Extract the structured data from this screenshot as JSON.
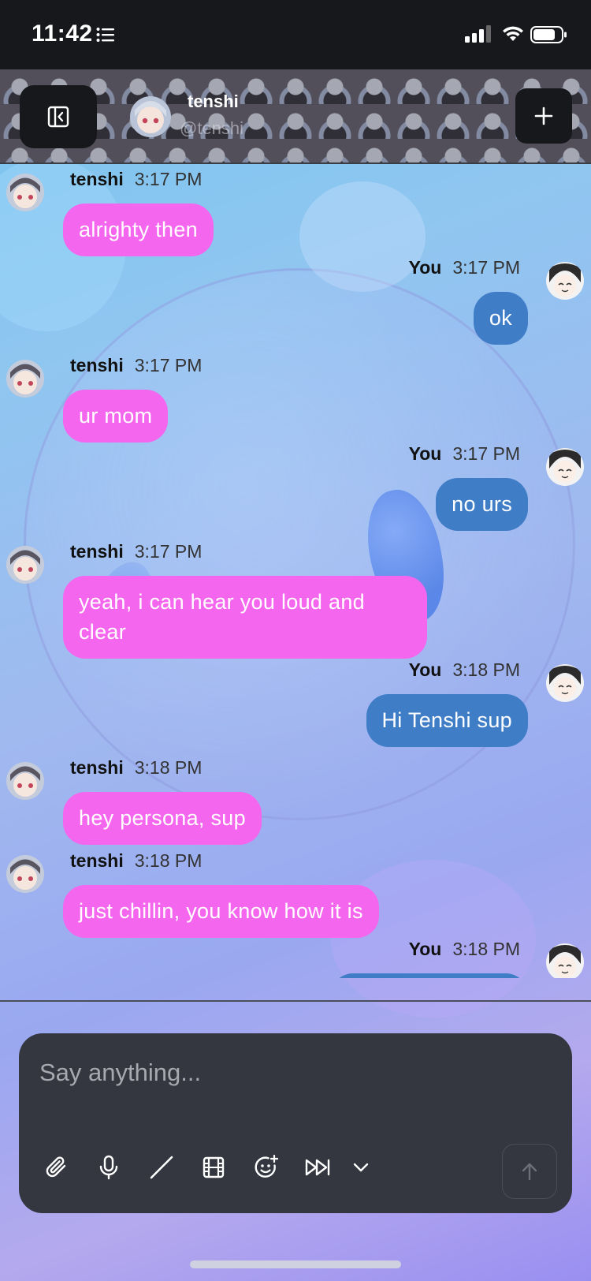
{
  "status_bar": {
    "time": "11:42"
  },
  "header": {
    "name": "tenshi",
    "handle": "@tenshi"
  },
  "messages": [
    {
      "sender": "tenshi",
      "time": "3:17 PM",
      "text": "alrighty then",
      "outgoing": false
    },
    {
      "sender": "You",
      "time": "3:17 PM",
      "text": "ok",
      "outgoing": true
    },
    {
      "sender": "tenshi",
      "time": "3:17 PM",
      "text": "ur mom",
      "outgoing": false
    },
    {
      "sender": "You",
      "time": "3:17 PM",
      "text": "no urs",
      "outgoing": true
    },
    {
      "sender": "tenshi",
      "time": "3:17 PM",
      "text": "yeah, i can hear you loud and clear",
      "outgoing": false
    },
    {
      "sender": "You",
      "time": "3:18 PM",
      "text": "Hi Tenshi sup",
      "outgoing": true
    },
    {
      "sender": "tenshi",
      "time": "3:18 PM",
      "text": "hey persona, sup",
      "outgoing": false
    },
    {
      "sender": "tenshi",
      "time": "3:18 PM",
      "text": "just chillin, you know how it is",
      "outgoing": false
    },
    {
      "sender": "You",
      "time": "3:18 PM",
      "text": "",
      "outgoing": true
    }
  ],
  "compose": {
    "placeholder": "Say anything...",
    "tools": [
      "paperclip-icon",
      "microphone-icon",
      "slash-icon",
      "film-icon",
      "emoji-add-icon",
      "fast-forward-icon",
      "chevron-down-icon"
    ]
  },
  "colors": {
    "incoming_bubble": "#f566ee",
    "outgoing_bubble": "#3f7dc7",
    "compose_bg": "#34373f",
    "status_bar_bg": "#17181b"
  }
}
